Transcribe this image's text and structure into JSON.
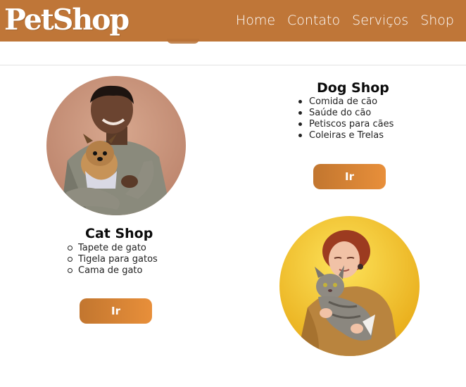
{
  "header": {
    "logo": "PetShop",
    "nav": [
      "Home",
      "Contato",
      "Serviços",
      "Shop"
    ]
  },
  "dog_shop": {
    "title": "Dog Shop",
    "items": [
      "Comida de cão",
      "Saúde do cão",
      "Petiscos para cães",
      "Coleiras e Trelas"
    ],
    "button": "Ir"
  },
  "cat_shop": {
    "title": "Cat Shop",
    "items": [
      "Tapete de gato",
      "Tigela para gatos",
      "Cama de gato"
    ],
    "button": "Ir"
  },
  "colors": {
    "header": "#bf7638",
    "button_start": "#c2762f",
    "button_end": "#e88f3a"
  }
}
